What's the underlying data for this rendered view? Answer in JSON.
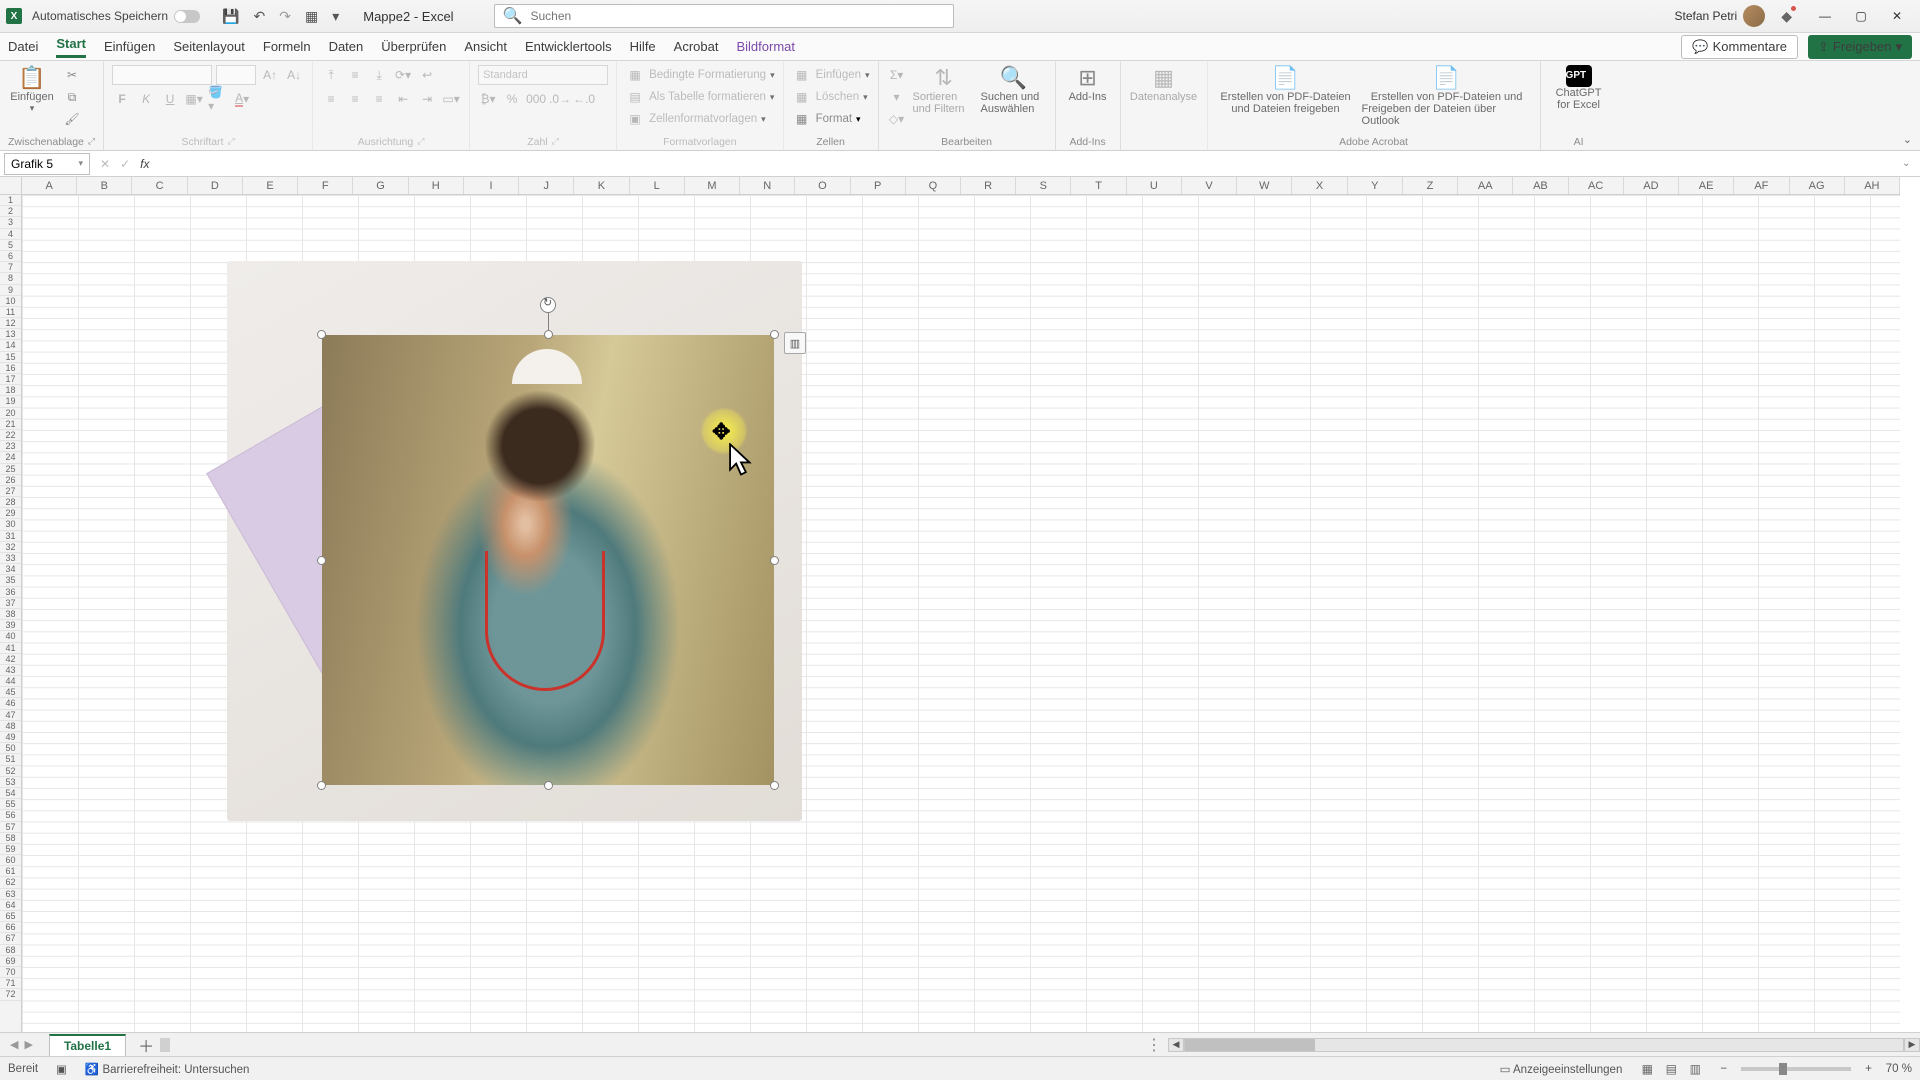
{
  "titlebar": {
    "autosave_label": "Automatisches Speichern",
    "doc_title": "Mappe2 - Excel",
    "search_placeholder": "Suchen",
    "user_name": "Stefan Petri"
  },
  "menu": {
    "tabs": [
      "Datei",
      "Start",
      "Einfügen",
      "Seitenlayout",
      "Formeln",
      "Daten",
      "Überprüfen",
      "Ansicht",
      "Entwicklertools",
      "Hilfe",
      "Acrobat",
      "Bildformat"
    ],
    "active_index": 1,
    "contextual_index": 11,
    "comments": "Kommentare",
    "share": "Freigeben"
  },
  "ribbon": {
    "groups": {
      "clipboard": {
        "label": "Zwischenablage",
        "paste": "Einfügen"
      },
      "font": {
        "label": "Schriftart",
        "bold": "F",
        "italic": "K",
        "underline": "U"
      },
      "alignment": {
        "label": "Ausrichtung"
      },
      "number": {
        "label": "Zahl",
        "format": "Standard"
      },
      "styles": {
        "label": "Formatvorlagen",
        "cond": "Bedingte Formatierung",
        "table": "Als Tabelle formatieren",
        "cell": "Zellenformatvorlagen"
      },
      "cells": {
        "label": "Zellen",
        "insert": "Einfügen",
        "delete": "Löschen",
        "format": "Format"
      },
      "editing": {
        "label": "Bearbeiten",
        "sort": "Sortieren und Filtern",
        "find": "Suchen und Auswählen"
      },
      "addins": {
        "label": "Add-Ins",
        "addins": "Add-Ins"
      },
      "analysis": {
        "label": "",
        "analyze": "Datenanalyse"
      },
      "acrobat": {
        "label": "Adobe Acrobat",
        "l1a": "Erstellen von PDF-Dateien",
        "l1b": "und Dateien freigeben",
        "l2a": "Erstellen von PDF-Dateien und",
        "l2b": "Freigeben der Dateien über Outlook"
      },
      "ai": {
        "label": "AI",
        "gpt1": "ChatGPT",
        "gpt2": "for Excel"
      }
    }
  },
  "formula": {
    "name_box": "Grafik 5"
  },
  "columns": [
    "A",
    "B",
    "C",
    "D",
    "E",
    "F",
    "G",
    "H",
    "I",
    "J",
    "K",
    "L",
    "M",
    "N",
    "O",
    "P",
    "Q",
    "R",
    "S",
    "T",
    "U",
    "V",
    "W",
    "X",
    "Y",
    "Z",
    "AA",
    "AB",
    "AC",
    "AD",
    "AE",
    "AF",
    "AG",
    "AH"
  ],
  "sheet": {
    "tab1": "Tabelle1"
  },
  "status": {
    "ready": "Bereit",
    "accessibility": "Barrierefreiheit: Untersuchen",
    "display": "Anzeigeeinstellungen",
    "zoom": "70 %"
  }
}
